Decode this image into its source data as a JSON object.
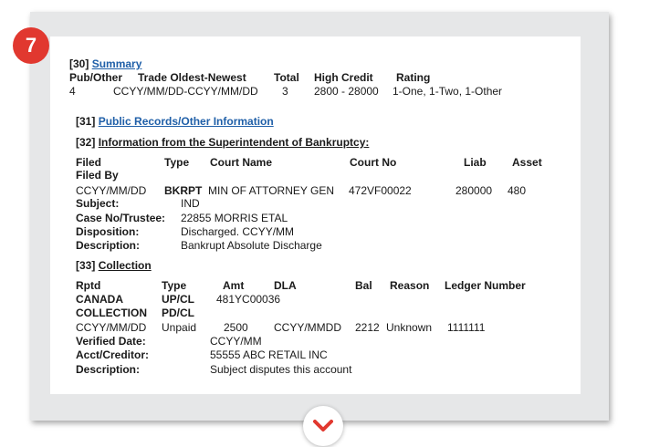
{
  "badge": "7",
  "summary": {
    "ref": "[30]",
    "link": "Summary",
    "headers": [
      "Pub/Other",
      "Trade Oldest-Newest",
      "Total",
      "High Credit",
      "Rating"
    ],
    "values": [
      "4",
      "CCYY/MM/DD-CCYY/MM/DD",
      "3",
      "2800 - 28000",
      "1-One, 1-Two, 1-Other"
    ]
  },
  "public_records": {
    "ref": "[31]",
    "link": "Public Records/Other Information"
  },
  "bankruptcy": {
    "ref": "[32]",
    "title": "Information from the Superintendent of Bankruptcy:",
    "headers": [
      "Filed",
      "Type",
      "Court Name",
      "Court No",
      "Liab",
      "Asset"
    ],
    "filed_by_label": "Filed By",
    "row": [
      "CCYY/MM/DD",
      "BKRPT",
      "MIN OF ATTORNEY GEN",
      "472VF00022",
      "280000",
      "480"
    ],
    "subject_label": "Subject:",
    "subject_value": "IND",
    "case_label": "Case No/Trustee:",
    "case_value": "22855 MORRIS ETAL",
    "disposition_label": "Disposition:",
    "disposition_value": "Discharged. CCYY/MM",
    "description_label": "Description:",
    "description_value": "Bankrupt Absolute Discharge"
  },
  "collection": {
    "ref": "[33]",
    "title": "Collection",
    "headers": [
      "Rptd",
      "Type",
      "Amt",
      "DLA",
      "Bal",
      "Reason",
      "Ledger Number"
    ],
    "line2_a": "CANADA",
    "line2_b": "UP/CL",
    "line2_c": "481YC00036",
    "line3_a": "COLLECTION",
    "line3_b": "PD/CL",
    "row": [
      "CCYY/MM/DD",
      "Unpaid",
      "2500",
      "CCYY/MMDD",
      "2212",
      "Unknown",
      "1111111"
    ],
    "verified_label": "Verified Date:",
    "verified_value": "CCYY/MM",
    "acct_label": "Acct/Creditor:",
    "acct_value": "55555 ABC RETAIL INC",
    "description_label": "Description:",
    "description_value": "Subject disputes this account"
  }
}
